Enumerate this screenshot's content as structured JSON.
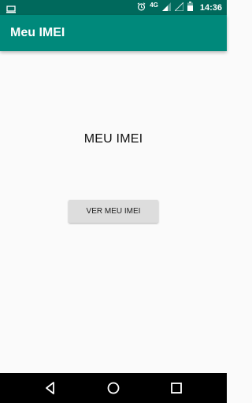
{
  "status_bar": {
    "network": "4G",
    "time": "14:36",
    "icons": [
      "screen-icon",
      "alarm-icon",
      "signal-icon",
      "signal-icon",
      "battery-icon"
    ]
  },
  "app_bar": {
    "title": "Meu IMEI",
    "color": "#00897b",
    "status_color": "#00695c"
  },
  "main": {
    "heading": "MEU IMEI",
    "button_label": "VER MEU IMEI"
  },
  "nav_bar": {
    "buttons": [
      "back-icon",
      "home-icon",
      "recents-icon"
    ]
  }
}
